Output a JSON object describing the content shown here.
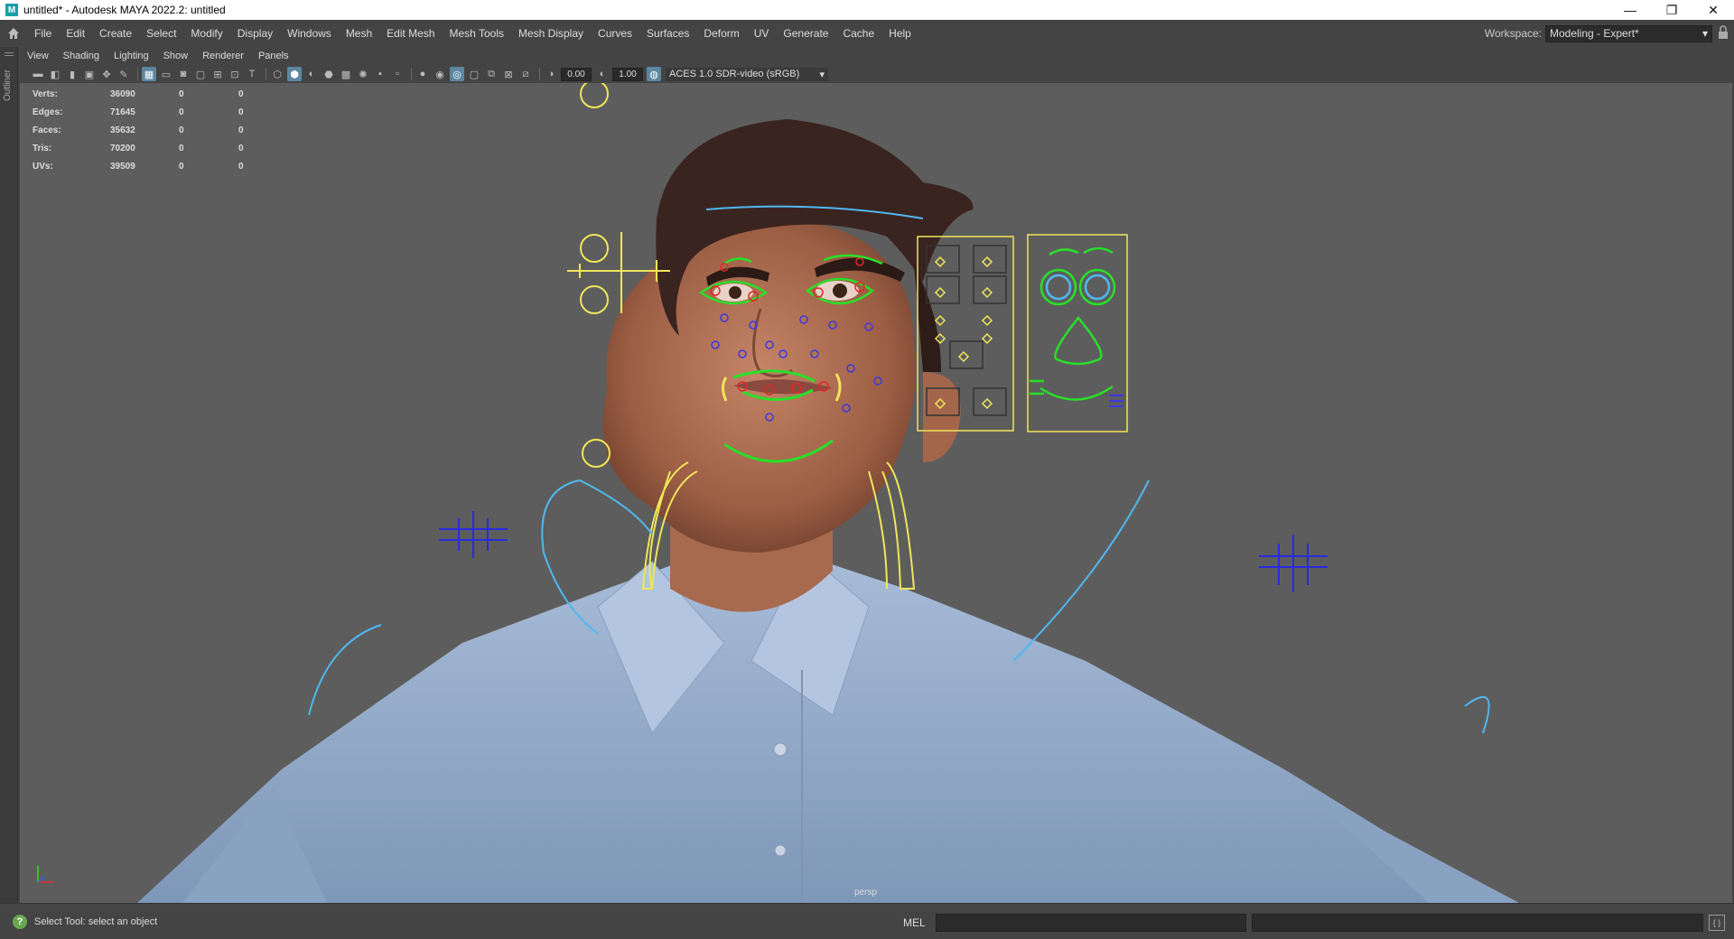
{
  "window": {
    "logo": "M",
    "title": "untitled* - Autodesk MAYA 2022.2: untitled",
    "controls": {
      "minimize": "—",
      "restore": "❐",
      "close": "✕"
    }
  },
  "menubar": {
    "items": [
      "File",
      "Edit",
      "Create",
      "Select",
      "Modify",
      "Display",
      "Windows",
      "Mesh",
      "Edit Mesh",
      "Mesh Tools",
      "Mesh Display",
      "Curves",
      "Surfaces",
      "Deform",
      "UV",
      "Generate",
      "Cache",
      "Help"
    ],
    "workspace_label": "Workspace:",
    "workspace_value": "Modeling - Expert*"
  },
  "outliner": {
    "label": "Outliner"
  },
  "panel_menu": {
    "items": [
      "View",
      "Shading",
      "Lighting",
      "Show",
      "Renderer",
      "Panels"
    ]
  },
  "panel_toolbar": {
    "near_clip": "0.00",
    "exposure": "1.00",
    "color_space": "ACES 1.0 SDR-video (sRGB)"
  },
  "hud": {
    "rows": [
      {
        "label": "Verts:",
        "value": "36090",
        "a": "0",
        "b": "0"
      },
      {
        "label": "Edges:",
        "value": "71645",
        "a": "0",
        "b": "0"
      },
      {
        "label": "Faces:",
        "value": "35632",
        "a": "0",
        "b": "0"
      },
      {
        "label": "Tris:",
        "value": "70200",
        "a": "0",
        "b": "0"
      },
      {
        "label": "UVs:",
        "value": "39509",
        "a": "0",
        "b": "0"
      }
    ]
  },
  "viewport": {
    "camera": "persp"
  },
  "statusbar": {
    "message": "Select Tool: select an object",
    "mel_label": "MEL"
  },
  "colors": {
    "viewport_bg": "#5d5d5d",
    "control_yellow": "#f0e65a",
    "control_green": "#28e028",
    "control_blue": "#2a2ae0",
    "control_cyan": "#4fb8f0",
    "control_red": "#e02828",
    "shirt": "#8aa4c4",
    "skin": "#b8775a",
    "hair": "#3a2420"
  }
}
